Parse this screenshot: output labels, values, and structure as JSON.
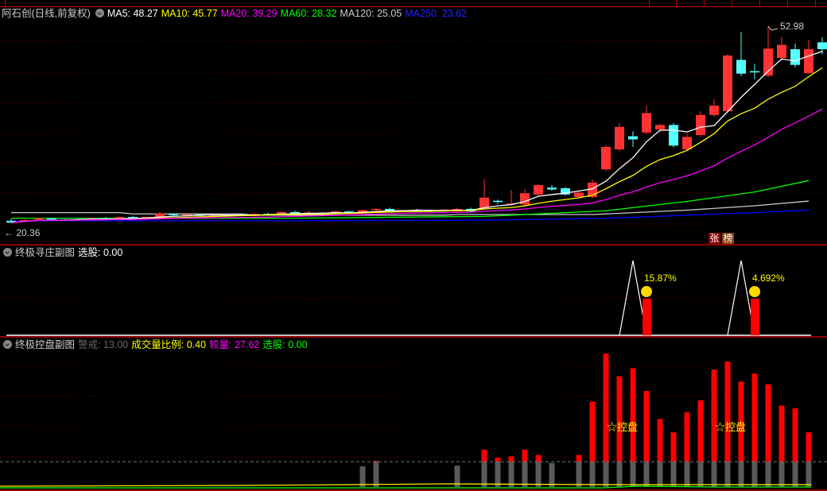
{
  "header": {
    "stock_name": "阿石创(日线,前复权)"
  },
  "ma_legend": [
    {
      "label": "MA5: 48.27",
      "color": "#ffffff"
    },
    {
      "label": "MA10: 45.77",
      "color": "#ffff00"
    },
    {
      "label": "MA20: 39.29",
      "color": "#ff00ff"
    },
    {
      "label": "MA60: 28.32",
      "color": "#00ff00"
    },
    {
      "label": "MA120: 25.05",
      "color": "#cccccc"
    },
    {
      "label": "MA250: 23.62",
      "color": "#0000ff"
    }
  ],
  "main_annotations": {
    "high_label": "52.98",
    "low_label": "← 20.36",
    "badge_1": "张",
    "badge_2": "榜"
  },
  "panel2": {
    "title": "终极寻庄副图",
    "value_label": "选股: 0.00",
    "signals": [
      {
        "label": "15.87%",
        "index": 46
      },
      {
        "label": "4.692%",
        "index": 54
      }
    ]
  },
  "panel3": {
    "title": "终极控盘副图",
    "items": [
      {
        "label": "警戒: 13.00",
        "color": "#555555"
      },
      {
        "label": "成交量比例: 0.40",
        "color": "#ffff00"
      },
      {
        "label": "较量: 27.62",
        "color": "#ff00ff"
      },
      {
        "label": "选股: 0.00",
        "color": "#00ff00"
      }
    ],
    "markers": [
      {
        "label": "☆控盘",
        "index": 45
      },
      {
        "label": "☆控盘",
        "index": 53
      }
    ]
  },
  "colors": {
    "up": "#ff3333",
    "down": "#54ffff",
    "grid": "#7a0000",
    "separator": "#c00000"
  },
  "chart_data": {
    "type": "candlestick",
    "ylim": [
      18.08,
      53.99
    ],
    "high": 52.98,
    "low": 20.36,
    "ohlc": [
      [
        21.9,
        22.2,
        21.5,
        21.6
      ],
      [
        22.0,
        22.1,
        21.8,
        22.0
      ],
      [
        22.1,
        22.4,
        21.9,
        22.3
      ],
      [
        22.3,
        22.4,
        22.0,
        22.1
      ],
      [
        22.1,
        22.2,
        21.9,
        22.0
      ],
      [
        22.0,
        22.2,
        21.9,
        22.1
      ],
      [
        22.2,
        22.4,
        22.0,
        22.3
      ],
      [
        22.3,
        22.5,
        22.1,
        22.2
      ],
      [
        22.2,
        22.6,
        22.1,
        22.5
      ],
      [
        22.5,
        22.7,
        22.1,
        22.2
      ],
      [
        22.4,
        22.6,
        22.3,
        22.5
      ],
      [
        22.2,
        23.3,
        22.1,
        23.1
      ],
      [
        23.0,
        23.1,
        22.6,
        22.8
      ],
      [
        22.8,
        23.2,
        22.6,
        22.9
      ],
      [
        22.9,
        23.0,
        22.6,
        22.7
      ],
      [
        22.6,
        22.8,
        22.5,
        22.7
      ],
      [
        22.7,
        23.0,
        22.6,
        22.9
      ],
      [
        22.9,
        23.1,
        22.7,
        22.8
      ],
      [
        22.7,
        23.2,
        22.6,
        23.0
      ],
      [
        23.0,
        23.2,
        22.8,
        22.9
      ],
      [
        22.9,
        23.4,
        22.8,
        23.3
      ],
      [
        23.3,
        23.5,
        23.0,
        23.1
      ],
      [
        23.1,
        23.5,
        22.9,
        23.2
      ],
      [
        23.2,
        23.3,
        22.8,
        23.0
      ],
      [
        23.0,
        23.5,
        22.9,
        23.4
      ],
      [
        23.4,
        23.5,
        23.0,
        23.1
      ],
      [
        23.1,
        23.7,
        23.0,
        23.6
      ],
      [
        23.6,
        23.9,
        23.4,
        23.8
      ],
      [
        23.8,
        24.0,
        23.4,
        23.5
      ],
      [
        23.5,
        23.7,
        23.3,
        23.6
      ],
      [
        23.6,
        23.8,
        23.4,
        23.5
      ],
      [
        23.5,
        23.7,
        23.3,
        23.4
      ],
      [
        23.4,
        23.8,
        23.2,
        23.7
      ],
      [
        23.4,
        24.0,
        23.3,
        23.8
      ],
      [
        23.8,
        24.0,
        23.3,
        23.4
      ],
      [
        23.9,
        28.6,
        23.7,
        25.6
      ],
      [
        25.1,
        25.3,
        24.6,
        24.9
      ],
      [
        24.6,
        26.8,
        24.4,
        24.7
      ],
      [
        24.5,
        27.0,
        24.3,
        26.3
      ],
      [
        26.1,
        27.8,
        25.9,
        27.6
      ],
      [
        27.2,
        27.6,
        26.7,
        26.9
      ],
      [
        27.1,
        27.3,
        25.9,
        26.1
      ],
      [
        25.7,
        26.6,
        25.5,
        26.4
      ],
      [
        25.7,
        28.5,
        25.5,
        28.0
      ],
      [
        30.1,
        34.0,
        29.8,
        33.7
      ],
      [
        33.3,
        37.5,
        33.0,
        36.9
      ],
      [
        35.4,
        36.2,
        33.7,
        34.9
      ],
      [
        36.0,
        40.3,
        35.7,
        39.1
      ],
      [
        36.5,
        37.4,
        36.0,
        37.2
      ],
      [
        37.2,
        37.5,
        33.6,
        33.9
      ],
      [
        33.3,
        35.8,
        33.0,
        35.3
      ],
      [
        35.6,
        39.4,
        35.3,
        38.8
      ],
      [
        38.8,
        41.3,
        38.5,
        40.3
      ],
      [
        39.4,
        48.5,
        39.2,
        48.3
      ],
      [
        47.6,
        52.1,
        45.0,
        45.4
      ],
      [
        45.8,
        47.0,
        44.5,
        45.6
      ],
      [
        45.1,
        52.98,
        44.8,
        49.4
      ],
      [
        47.9,
        51.3,
        47.5,
        50.0
      ],
      [
        49.3,
        50.2,
        46.4,
        46.8
      ],
      [
        45.5,
        50.8,
        45.3,
        49.3
      ],
      [
        50.4,
        51.2,
        48.5,
        49.3
      ]
    ],
    "ma60": [
      [
        0,
        22.3
      ],
      [
        20,
        22.3
      ],
      [
        35,
        22.6
      ],
      [
        44,
        23.5
      ],
      [
        50,
        25.0
      ],
      [
        55,
        26.5
      ],
      [
        59,
        28.32
      ]
    ],
    "ma120": [
      [
        0,
        23.2
      ],
      [
        8,
        23.2
      ],
      [
        9,
        23.0
      ],
      [
        17,
        23.0
      ],
      [
        18,
        22.8
      ],
      [
        32,
        22.8
      ],
      [
        33,
        22.9
      ],
      [
        43,
        22.9
      ],
      [
        50,
        23.6
      ],
      [
        55,
        24.3
      ],
      [
        59,
        25.05
      ]
    ],
    "ma250": [
      [
        0,
        21.9
      ],
      [
        20,
        21.9
      ],
      [
        35,
        22.0
      ],
      [
        44,
        22.3
      ],
      [
        50,
        22.8
      ],
      [
        55,
        23.2
      ],
      [
        59,
        23.62
      ]
    ],
    "volume_relative": [
      2,
      2,
      2,
      2,
      2,
      2,
      2,
      2,
      2,
      2,
      2,
      2,
      2,
      2,
      2,
      2,
      2,
      2,
      2,
      2,
      2,
      2,
      2,
      2,
      2,
      2,
      15.5,
      19.6,
      2,
      2,
      2,
      2,
      2,
      16,
      2,
      28,
      22,
      23,
      28,
      24,
      18,
      2,
      24,
      64,
      100,
      83,
      89,
      72,
      51,
      41,
      56,
      65,
      88,
      94,
      79,
      85,
      77,
      61,
      59,
      41
    ],
    "volume_threshold": 19,
    "signal_peaks": [
      46,
      54
    ]
  }
}
